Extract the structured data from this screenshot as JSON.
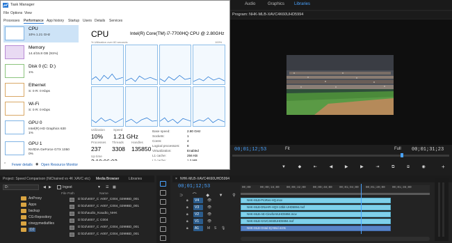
{
  "premiere": {
    "workspaces": [
      "Audio",
      "Graphics",
      "Libraries"
    ],
    "active_workspace": "Libraries",
    "program_tab": "Program: NHK-MLB-XAVC4K60UHD5994",
    "program_timecode": "00;01;12;53",
    "fit_label": "Fit",
    "full_label": "Full",
    "program_duration": "00;01;31;23"
  },
  "task_manager": {
    "title": "Task Manager",
    "menu": [
      "File",
      "Options",
      "View"
    ],
    "tabs": [
      "Processes",
      "Performance",
      "App history",
      "Startup",
      "Users",
      "Details",
      "Services"
    ],
    "active_tab": "Performance",
    "sidebar": [
      {
        "name": "CPU",
        "sub": "10%  1.21 GHz",
        "color": "#2a7ad5"
      },
      {
        "name": "Memory",
        "sub": "14.4/15.8 GB (91%)",
        "color": "#8a3fb4"
      },
      {
        "name": "Disk 0 (C: D:)",
        "sub": "1%",
        "color": "#4aa63a"
      },
      {
        "name": "Ethernet",
        "sub": "S: 0  R: 0 Kbps",
        "color": "#c27a2a"
      },
      {
        "name": "Wi-Fi",
        "sub": "S: 0  R: 0 Kbps",
        "color": "#c27a2a"
      },
      {
        "name": "GPU 0",
        "sub": "Intel(R) HD Graphics 630\n1%",
        "color": "#2a7ad5"
      },
      {
        "name": "GPU 1",
        "sub": "NVIDIA GeForce GTX 1050\n0%",
        "color": "#2a7ad5"
      }
    ],
    "cpu_header": "CPU",
    "cpu_model": "Intel(R) Core(TM) i7-7700HQ CPU @ 2.80GHz",
    "graph_caption": "% Utilization over 60 seconds",
    "graph_max": "100%",
    "stats": {
      "utilization_label": "Utilization",
      "utilization": "10%",
      "speed_label": "Speed",
      "speed": "1.21 GHz",
      "processes_label": "Processes",
      "processes": "237",
      "threads_label": "Threads",
      "threads": "3308",
      "handles_label": "Handles",
      "handles": "135850",
      "uptime_label": "Up time",
      "uptime": "2:10:06:03"
    },
    "details": [
      {
        "k": "Base speed:",
        "v": "2.80 GHz"
      },
      {
        "k": "Sockets:",
        "v": "1"
      },
      {
        "k": "Cores:",
        "v": "4"
      },
      {
        "k": "Logical processors:",
        "v": "8"
      },
      {
        "k": "Virtualization:",
        "v": "Enabled"
      },
      {
        "k": "L1 cache:",
        "v": "256 KB"
      },
      {
        "k": "L2 cache:",
        "v": "1.0 MB"
      },
      {
        "k": "L3 cache:",
        "v": "6.0 MB"
      }
    ],
    "fewer_details": "Fewer details",
    "open_monitor": "Open Resource Monitor"
  },
  "project_panel": {
    "tabs": [
      "Project: Speed Comparison (NiChained vs 4K XAVC etc)",
      "Media Browser",
      "Libraries"
    ],
    "active_tab": "Media Browser",
    "drive": "D:",
    "ingest_label": "Ingest",
    "folders": [
      "AnProxy",
      "Apps",
      "backup",
      "CG-Repository",
      "cinegymediafiles",
      "D2"
    ],
    "col_filepath": "File Path",
    "col_name": "Name",
    "files": [
      {
        "path": "D:\\D2\\4007_C",
        "name": "A007_C004_0299BD_001"
      },
      {
        "path": "D:\\D2\\4007_C",
        "name": "A007_C004_0299BD_001"
      },
      {
        "path": "D:\\D2\\audio_N",
        "name": "audio_NHK"
      },
      {
        "path": "D:\\D2\\4007_C",
        "name": "C004"
      },
      {
        "path": "D:\\D2\\4007_C",
        "name": "A007_C004_0299BD_001"
      },
      {
        "path": "D:\\D2\\4007_C",
        "name": "A007_C004_0299BD_001"
      }
    ]
  },
  "timeline": {
    "tab": "NHK-MLB-XAVC4K60UHD5994",
    "timecode": "00;01;12;53",
    "ruler": [
      "00;00",
      "00;00;16;00",
      "00;00;32;00",
      "00;00;48;00",
      "00;01;04;00",
      "00;01;20;00",
      "00;01;36;00"
    ],
    "tracks": [
      "V4",
      "V3",
      "V2",
      "V1",
      "A1"
    ],
    "clips": [
      "NHK-MLB-ProRes-HQ.mov",
      "NHK-MLB-DNxHR-HQX-10bit-UHD5994.mxf",
      "NHK-MLB-AE-CineformUHD5994.mov",
      "NHK-MLB-XAVC4K60UHD5994.mxf",
      "NHK-MLB-Ontal-Dj-Ntsd.m2ts"
    ]
  },
  "colors": {
    "accent_blue": "#4aa3ff",
    "clip_cyan": "#7fd0ea",
    "task_blue": "#2a7ad5"
  }
}
